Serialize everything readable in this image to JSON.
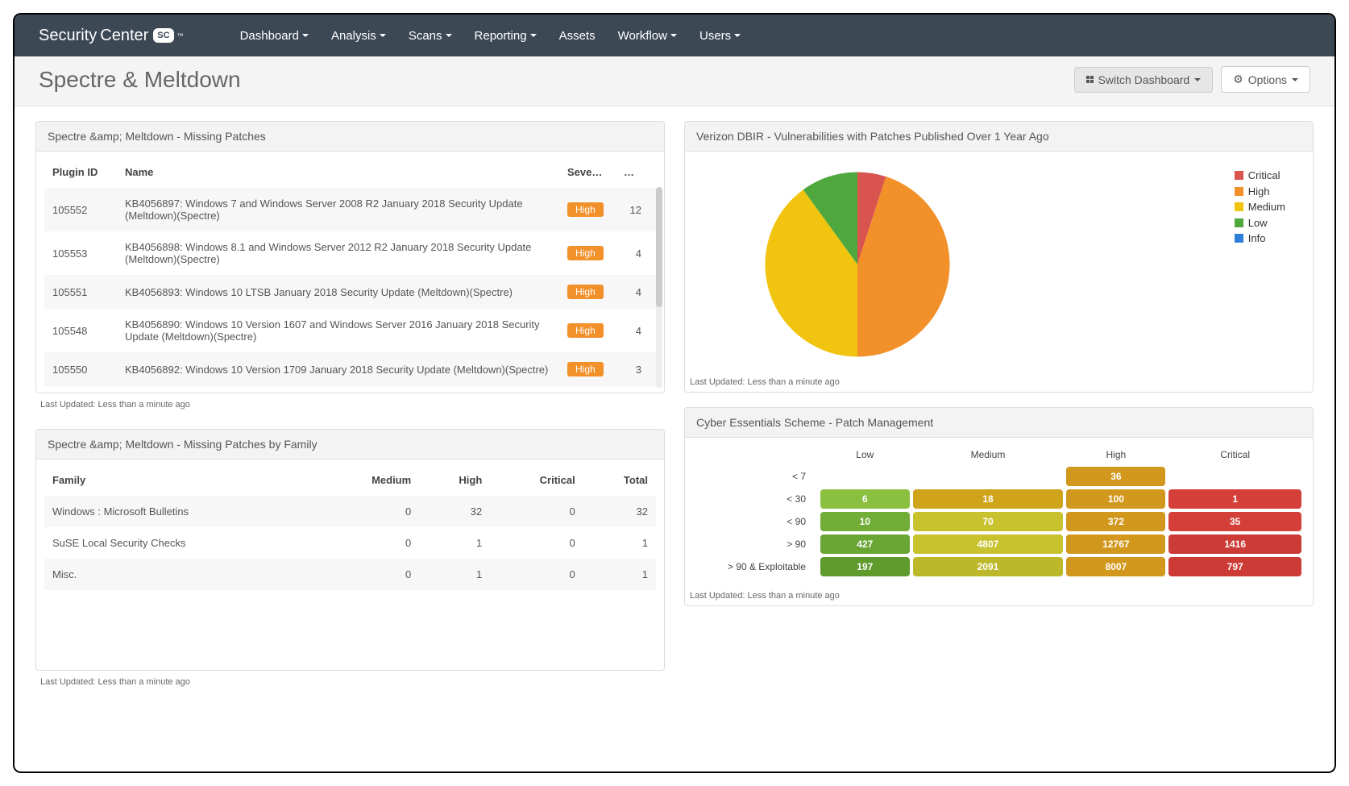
{
  "brand": {
    "name1": "Security",
    "name2": "Center",
    "badge": "SC",
    "tm": "™"
  },
  "nav": {
    "items": [
      {
        "label": "Dashboard",
        "hasCaret": true
      },
      {
        "label": "Analysis",
        "hasCaret": true
      },
      {
        "label": "Scans",
        "hasCaret": true
      },
      {
        "label": "Reporting",
        "hasCaret": true
      },
      {
        "label": "Assets",
        "hasCaret": false
      },
      {
        "label": "Workflow",
        "hasCaret": true
      },
      {
        "label": "Users",
        "hasCaret": true
      }
    ]
  },
  "titlebar": {
    "title": "Spectre & Meltdown",
    "switch_label": "Switch Dashboard",
    "options_label": "Options"
  },
  "panels": {
    "missingPatches": {
      "title": "Spectre &amp; Meltdown - Missing Patches",
      "columns": [
        "Plugin ID",
        "Name",
        "Seve…",
        "…"
      ],
      "rows": [
        {
          "plugin": "105552",
          "name": "KB4056897: Windows 7 and Windows Server 2008 R2 January 2018 Security Update (Meltdown)(Spectre)",
          "severity": "High",
          "count": "12"
        },
        {
          "plugin": "105553",
          "name": "KB4056898: Windows 8.1 and Windows Server 2012 R2 January 2018 Security Update (Meltdown)(Spectre)",
          "severity": "High",
          "count": "4"
        },
        {
          "plugin": "105551",
          "name": "KB4056893: Windows 10 LTSB January 2018 Security Update (Meltdown)(Spectre)",
          "severity": "High",
          "count": "4"
        },
        {
          "plugin": "105548",
          "name": "KB4056890: Windows 10 Version 1607 and Windows Server 2016 January 2018 Security Update (Meltdown)(Spectre)",
          "severity": "High",
          "count": "4"
        },
        {
          "plugin": "105550",
          "name": "KB4056892: Windows 10 Version 1709 January 2018 Security Update (Meltdown)(Spectre)",
          "severity": "High",
          "count": "3"
        }
      ],
      "lastUpdated": "Last Updated: Less than a minute ago"
    },
    "byFamily": {
      "title": "Spectre &amp; Meltdown - Missing Patches by Family",
      "columns": [
        "Family",
        "Medium",
        "High",
        "Critical",
        "Total"
      ],
      "rows": [
        {
          "family": "Windows : Microsoft Bulletins",
          "medium": "0",
          "high": "32",
          "critical": "0",
          "total": "32"
        },
        {
          "family": "SuSE Local Security Checks",
          "medium": "0",
          "high": "1",
          "critical": "0",
          "total": "1"
        },
        {
          "family": "Misc.",
          "medium": "0",
          "high": "1",
          "critical": "0",
          "total": "1"
        }
      ],
      "lastUpdated": "Last Updated: Less than a minute ago"
    },
    "dbir": {
      "title": "Verizon DBIR - Vulnerabilities with Patches Published Over 1 Year Ago",
      "legend": [
        {
          "label": "Critical",
          "color": "#d9534f"
        },
        {
          "label": "High",
          "color": "#f29029"
        },
        {
          "label": "Medium",
          "color": "#f1c40f"
        },
        {
          "label": "Low",
          "color": "#4fa83d"
        },
        {
          "label": "Info",
          "color": "#2f7ed8"
        }
      ],
      "lastUpdated": "Last Updated: Less than a minute ago"
    },
    "ces": {
      "title": "Cyber Essentials Scheme - Patch Management",
      "cols": [
        "Low",
        "Medium",
        "High",
        "Critical"
      ],
      "rows": [
        {
          "label": "< 7",
          "vals": [
            "0",
            "0",
            "36",
            "0"
          ],
          "classes": [
            "zero",
            "zero",
            "g-high1",
            "zero"
          ]
        },
        {
          "label": "< 30",
          "vals": [
            "6",
            "18",
            "100",
            "1"
          ],
          "classes": [
            "g-low1",
            "g-med0",
            "g-high2",
            "g-crit1"
          ]
        },
        {
          "label": "< 90",
          "vals": [
            "10",
            "70",
            "372",
            "35"
          ],
          "classes": [
            "g-low2",
            "g-med1",
            "g-high3",
            "g-crit1"
          ]
        },
        {
          "label": "> 90",
          "vals": [
            "427",
            "4807",
            "12767",
            "1416"
          ],
          "classes": [
            "g-low3",
            "g-med2",
            "g-high4",
            "g-crit2"
          ]
        },
        {
          "label": "> 90 & Exploitable",
          "vals": [
            "197",
            "2091",
            "8007",
            "797"
          ],
          "classes": [
            "g-low4",
            "g-med3",
            "g-high4",
            "g-crit2"
          ]
        }
      ],
      "lastUpdated": "Last Updated: Less than a minute ago"
    }
  },
  "chart_data": {
    "type": "pie",
    "title": "Verizon DBIR - Vulnerabilities with Patches Published Over 1 Year Ago",
    "series": [
      {
        "name": "Critical",
        "value": 5,
        "color": "#d9534f"
      },
      {
        "name": "High",
        "value": 45,
        "color": "#f29029"
      },
      {
        "name": "Medium",
        "value": 40,
        "color": "#f1c40f"
      },
      {
        "name": "Low",
        "value": 10,
        "color": "#4fa83d"
      },
      {
        "name": "Info",
        "value": 0,
        "color": "#2f7ed8"
      }
    ],
    "note": "Values are approximate percentages read from slice angles; no numeric labels are printed on the chart."
  }
}
